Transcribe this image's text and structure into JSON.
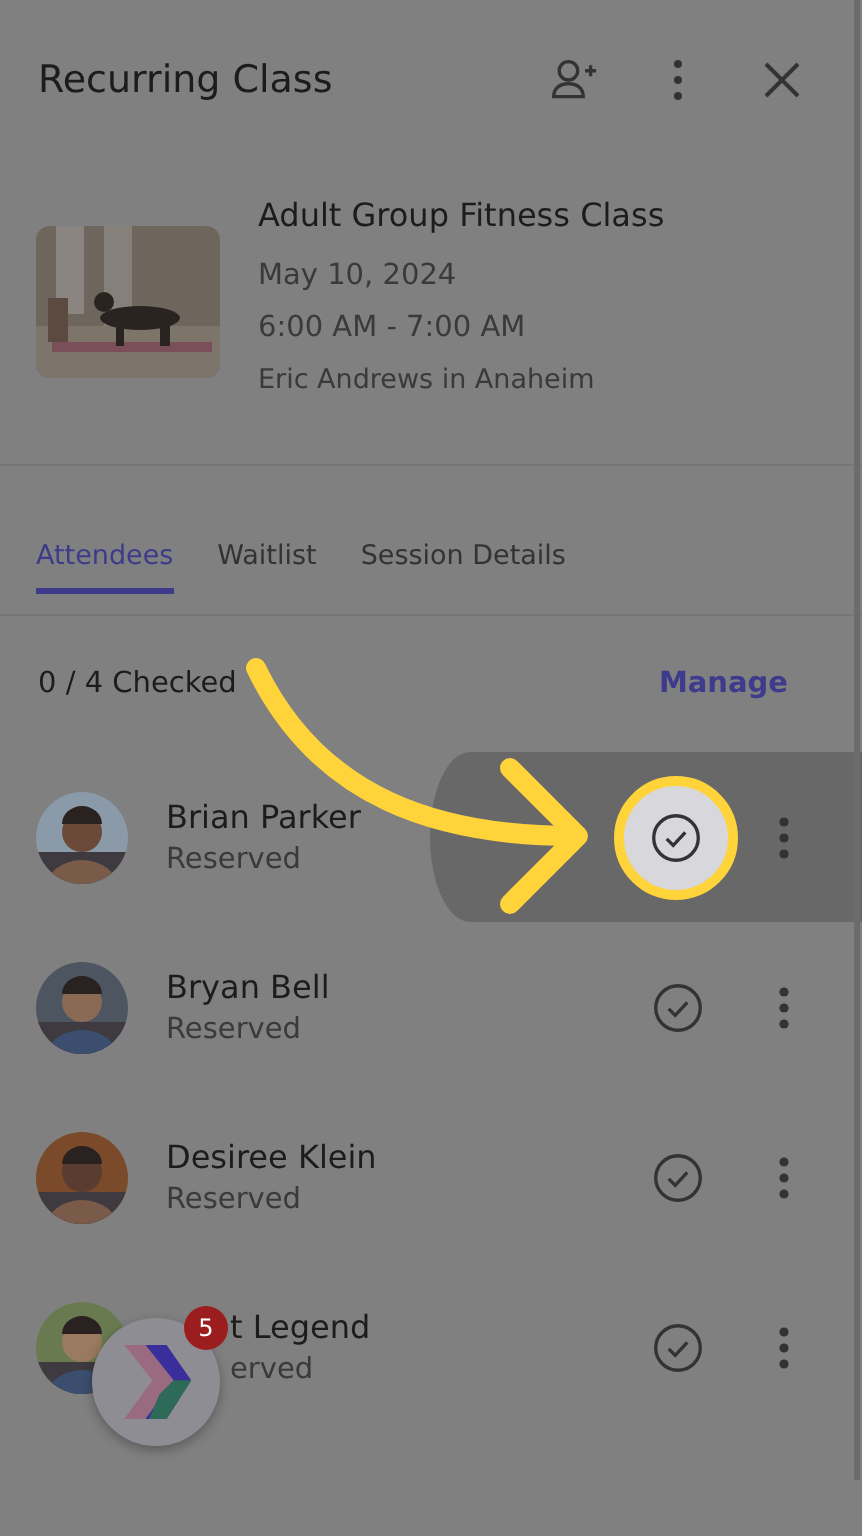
{
  "header": {
    "title": "Recurring Class"
  },
  "class": {
    "name": "Adult Group Fitness Class",
    "date": "May 10, 2024",
    "time": "6:00 AM - 7:00 AM",
    "instructor": "Eric Andrews in Anaheim"
  },
  "tabs": [
    {
      "label": "Attendees",
      "selected": true
    },
    {
      "label": "Waitlist",
      "selected": false
    },
    {
      "label": "Session Details",
      "selected": false
    }
  ],
  "summary": {
    "count": "0 / 4 Checked",
    "action": "Manage"
  },
  "attendees": [
    {
      "name": "Brian Parker",
      "status": "Reserved",
      "highlighted": true
    },
    {
      "name": "Bryan Bell",
      "status": "Reserved",
      "highlighted": false
    },
    {
      "name": "Desiree Klein",
      "status": "Reserved",
      "highlighted": false
    },
    {
      "name": "t Legend",
      "status": "erved",
      "highlighted": false
    }
  ],
  "launcher": {
    "badge": "5"
  }
}
